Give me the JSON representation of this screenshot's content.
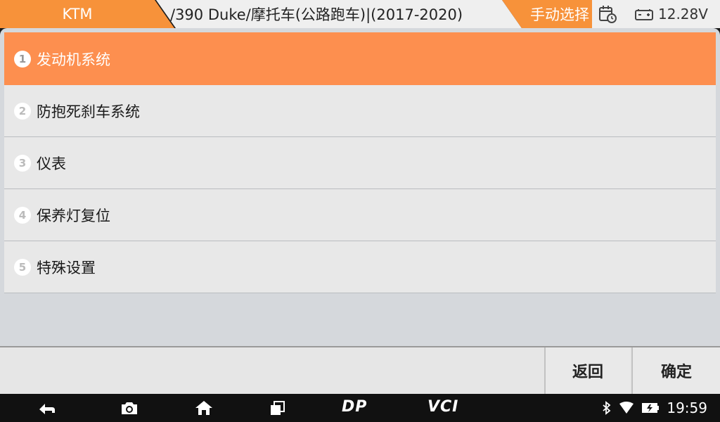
{
  "breadcrumb": {
    "brand": "KTM",
    "model": "/390 Duke/摩托车(公路跑车)|(2017-2020)",
    "mode": "手动选择"
  },
  "tray": {
    "voltage": "12.28V",
    "icons": [
      "calendar-clock-icon",
      "battery-icon"
    ]
  },
  "menu": {
    "items": [
      {
        "num": "1",
        "label": "发动机系统",
        "selected": true
      },
      {
        "num": "2",
        "label": "防抱死刹车系统",
        "selected": false
      },
      {
        "num": "3",
        "label": "仪表",
        "selected": false
      },
      {
        "num": "4",
        "label": "保养灯复位",
        "selected": false
      },
      {
        "num": "5",
        "label": "特殊设置",
        "selected": false
      }
    ]
  },
  "actions": {
    "back_label": "返回",
    "confirm_label": "确定"
  },
  "navbar": {
    "icons": [
      "back-arrow-icon",
      "camera-icon",
      "home-icon",
      "recents-icon",
      "dp-icon",
      "vci-icon"
    ],
    "dp_text": "DP",
    "vci_text": "VCI",
    "time": "19:59",
    "status_icons": [
      "bluetooth-icon",
      "wifi-icon",
      "battery-status-icon"
    ]
  },
  "colors": {
    "accent": "#fd8f4f",
    "crumb_orange": "#f7923a"
  }
}
